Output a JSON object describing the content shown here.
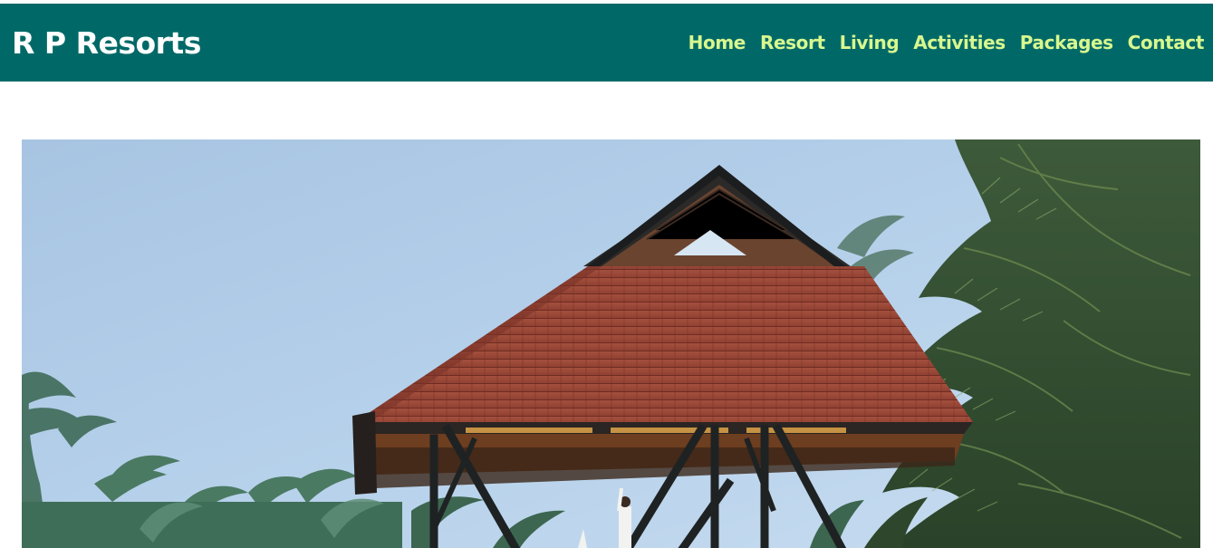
{
  "header": {
    "brand": "R P Resorts",
    "background_color": "#006967",
    "nav_color": "#d8f78f",
    "nav": [
      {
        "label": "Home"
      },
      {
        "label": "Resort"
      },
      {
        "label": "Living"
      },
      {
        "label": "Activities"
      },
      {
        "label": "Packages"
      },
      {
        "label": "Contact"
      }
    ]
  },
  "hero": {
    "subject": "tiled-roof pavilion among coconut palms"
  }
}
